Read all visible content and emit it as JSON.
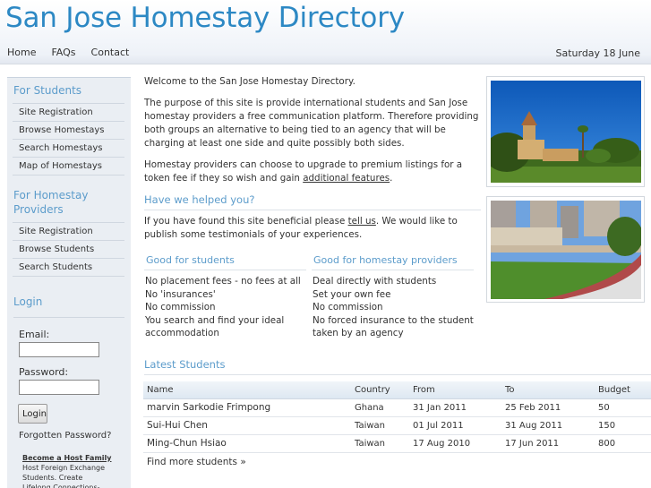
{
  "header": {
    "title": "San Jose Homestay Directory",
    "nav": [
      "Home",
      "FAQs",
      "Contact"
    ],
    "date": "Saturday 18 June"
  },
  "sidebar": {
    "students_heading": "For Students",
    "students_links": [
      "Site Registration",
      "Browse Homestays",
      "Search Homestays",
      "Map of Homestays"
    ],
    "providers_heading": "For Homestay Providers",
    "providers_links": [
      "Site Registration",
      "Browse Students",
      "Search Students"
    ],
    "login_heading": "Login",
    "email_label": "Email:",
    "password_label": "Password:",
    "login_button": "Login",
    "forgot_link": "Forgotten Password?",
    "promo_title": "Become a Host Family",
    "promo_text": "Host Foreign Exchange Students. Create Lifelong Connections-"
  },
  "main": {
    "welcome": "Welcome to the San Jose Homestay Directory.",
    "purpose": "The purpose of this site is provide international students and San Jose homestay providers a free communication platform. Therefore providing both groups an alternative to being tied to an agency that will be charging at least one side and quite possibly both sides.",
    "upgrade_before": "Homestay providers can choose to upgrade to premium listings for a token fee if they so wish and gain ",
    "upgrade_link": "additional features",
    "upgrade_after": ".",
    "helped_heading": "Have we helped you?",
    "helped_before": "If you have found this site beneficial please ",
    "helped_link": "tell us",
    "helped_after": ". We would like to publish some testimonials of your experiences.",
    "good_students_heading": "Good for students",
    "good_students": [
      "No placement fees - no fees at all",
      "No 'insurances'",
      "No commission",
      "You search and find your ideal accommodation"
    ],
    "good_providers_heading": "Good for homestay providers",
    "good_providers": [
      "Deal directly with students",
      "Set your own fee",
      "No commission",
      "No forced insurance to the student taken by an agency"
    ]
  },
  "latest": {
    "heading": "Latest Students",
    "columns": [
      "Name",
      "Country",
      "From",
      "To",
      "Budget"
    ],
    "rows": [
      [
        "marvin Sarkodie Frimpong",
        "Ghana",
        "31 Jan 2011",
        "25 Feb 2011",
        "50"
      ],
      [
        "Sui-Hui Chen",
        "Taiwan",
        "01 Jul 2011",
        "31 Aug 2011",
        "150"
      ],
      [
        "Ming-Chun Hsiao",
        "Taiwan",
        "17 Aug 2010",
        "17 Jun 2011",
        "800"
      ]
    ],
    "find_more": "Find more students »"
  },
  "colors": {
    "title": "#2c88c4",
    "heading": "#5c9ccb",
    "sidebar_bg": "#eaeef3"
  }
}
